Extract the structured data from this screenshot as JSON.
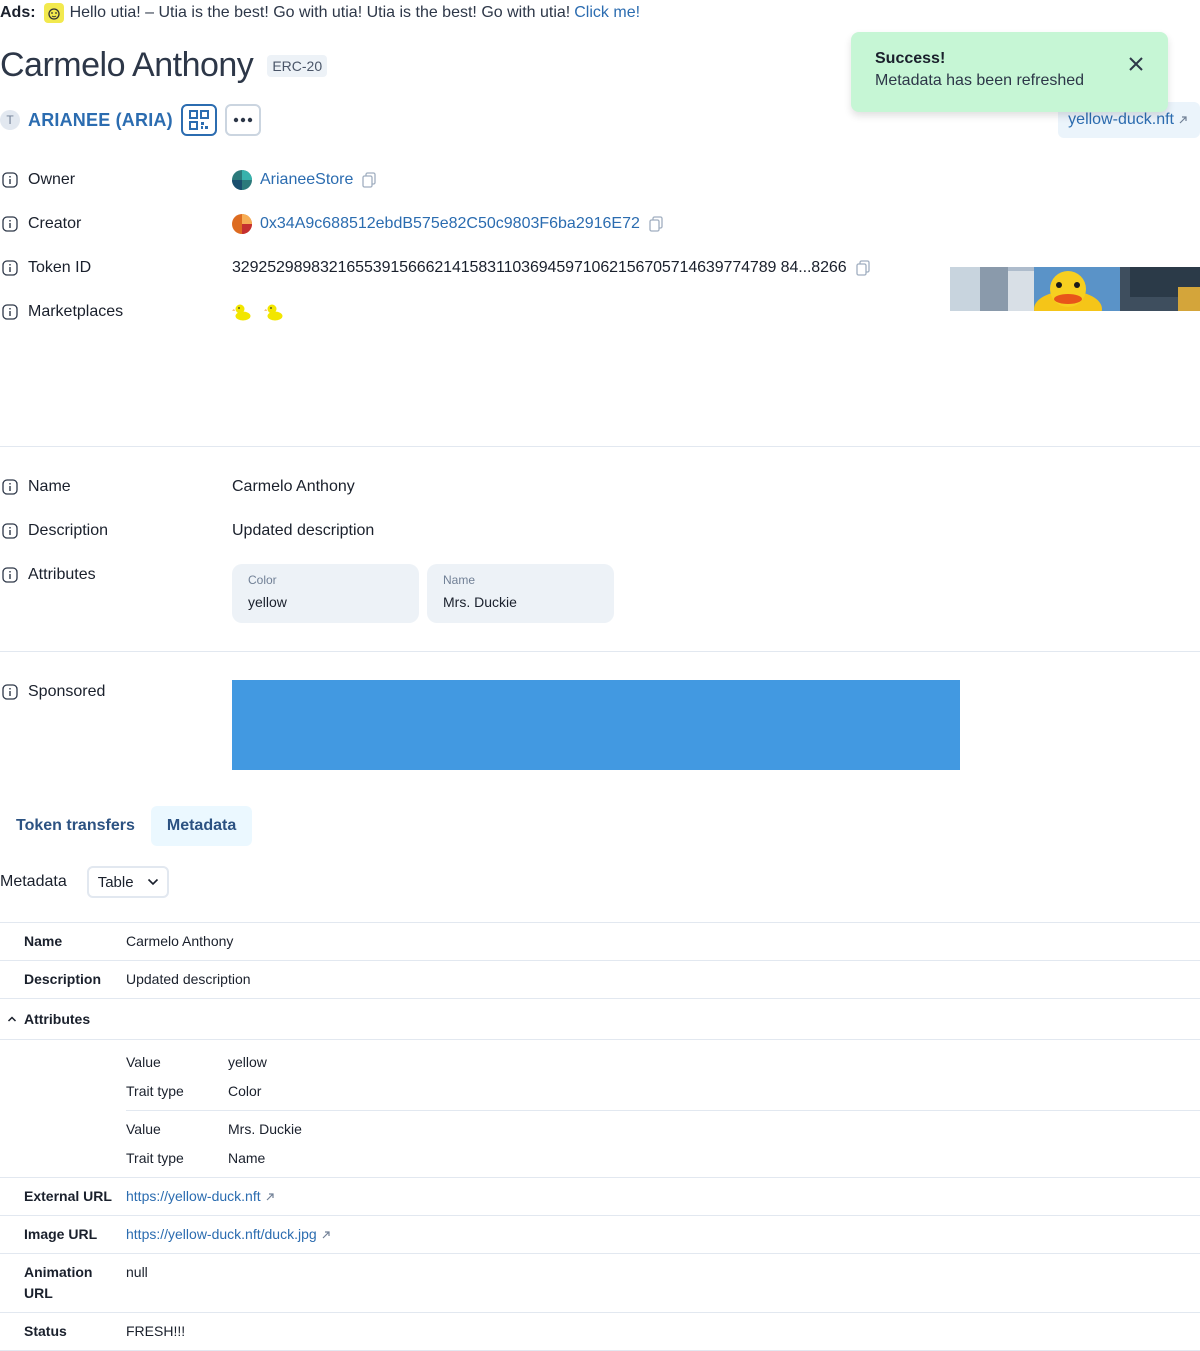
{
  "ads": {
    "label": "Ads:",
    "text": "Hello utia! – Utia is the best! Go with utia! Utia is the best! Go with utia!",
    "link": "Click me!"
  },
  "header": {
    "title": "Carmelo Anthony",
    "badge": "ERC-20",
    "token_avatar": "T",
    "token_name": "ARIANEE (ARIA)",
    "external_link": "yellow-duck.nft"
  },
  "toast": {
    "title": "Success!",
    "message": "Metadata has been refreshed"
  },
  "details": {
    "owner_label": "Owner",
    "owner_value": "ArianeeStore",
    "creator_label": "Creator",
    "creator_value": "0x34A9c688512ebdB575e82C50c9803F6ba2916E72",
    "token_id_label": "Token ID",
    "token_id_value": "32925298983216553915666214158311036945971062156705714639774789 84...8266",
    "marketplaces_label": "Marketplaces"
  },
  "info": {
    "name_label": "Name",
    "name_value": "Carmelo Anthony",
    "description_label": "Description",
    "description_value": "Updated description",
    "attributes_label": "Attributes",
    "attributes": [
      {
        "key": "Color",
        "value": "yellow"
      },
      {
        "key": "Name",
        "value": "Mrs. Duckie"
      }
    ],
    "sponsored_label": "Sponsored"
  },
  "tabs": [
    {
      "label": "Token transfers"
    },
    {
      "label": "Metadata"
    }
  ],
  "metadata": {
    "label": "Metadata",
    "select_value": "Table",
    "rows": {
      "name_key": "Name",
      "name_value": "Carmelo Anthony",
      "description_key": "Description",
      "description_value": "Updated description",
      "attributes_key": "Attributes",
      "attr1_value_key": "Value",
      "attr1_value": "yellow",
      "attr1_trait_key": "Trait type",
      "attr1_trait": "Color",
      "attr2_value_key": "Value",
      "attr2_value": "Mrs. Duckie",
      "attr2_trait_key": "Trait type",
      "attr2_trait": "Name",
      "external_url_key": "External URL",
      "external_url_value": "https://yellow-duck.nft",
      "image_url_key": "Image URL",
      "image_url_value": "https://yellow-duck.nft/duck.jpg",
      "animation_url_key_1": "Animation",
      "animation_url_key_2": "URL",
      "animation_url_value": "null",
      "status_key": "Status",
      "status_value": "FRESH!!!"
    }
  },
  "colors": {
    "link": "#2b6cb0",
    "toast_bg": "#c6f6d5",
    "sponsor_bg": "#4299e1",
    "tab_active_bg": "#ebf8ff"
  }
}
